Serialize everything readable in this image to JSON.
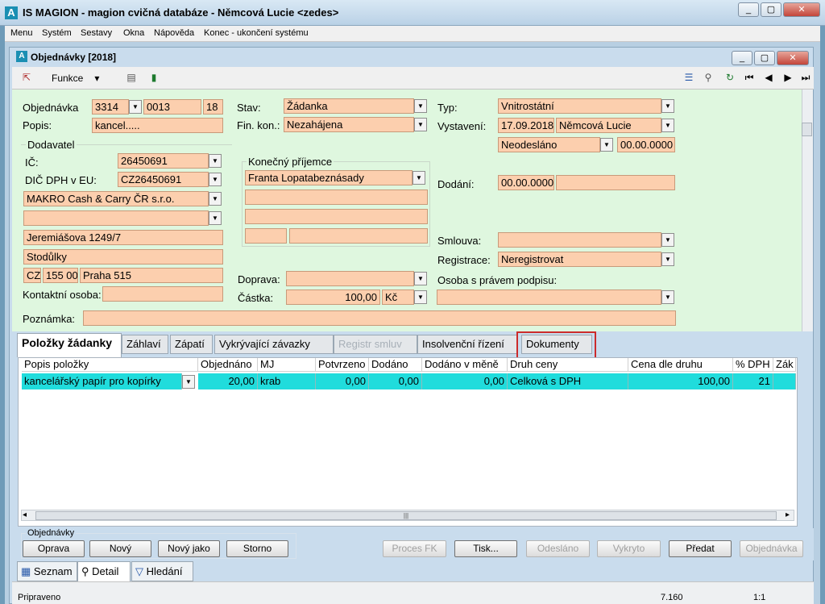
{
  "window": {
    "title": "IS MAGION - magion cvičná databáze - Němcová Lucie <zedes>",
    "logo": "A",
    "min": "▭",
    "max": "▢",
    "close": "✕"
  },
  "menu": [
    "Menu",
    "Systém",
    "Sestavy",
    "Okna",
    "Nápověda",
    "Konec - ukončení systému"
  ],
  "child": {
    "title": "Objednávky [2018]",
    "logo": "A"
  },
  "toolbar": {
    "funkce": "Funkce",
    "caret": "▾",
    "icons": [
      "export-icon",
      "print-icon",
      "book-icon",
      "list-icon",
      "search-doc-icon",
      "refresh-icon",
      "first-icon",
      "prev-icon",
      "next-icon",
      "last-icon"
    ],
    "glyphs": [
      "⇱",
      "▤",
      "▮",
      "☰",
      "⚲",
      "↻",
      "⏮",
      "◀",
      "▶",
      "⏭"
    ]
  },
  "form": {
    "objednavka_lbl": "Objednávka",
    "objednavka_rada": "3314",
    "objednavka_cislo": "0013",
    "objednavka_rok": "18",
    "popis_lbl": "Popis:",
    "popis": "kancel.....",
    "dodavatel_lbl": "Dodavatel",
    "ic_lbl": "IČ:",
    "ic": "26450691",
    "dic_lbl": "DIČ DPH v EU:",
    "dic": "CZ26450691",
    "firma": "MAKRO Cash & Carry ČR s.r.o.",
    "firma2": "",
    "ulice": "Jeremiášova 1249/7",
    "obec": "Stodůlky",
    "zeme": "CZ",
    "psc": "155 00",
    "mesto": "Praha 515",
    "kontakt_lbl": "Kontaktní osoba:",
    "kontakt": "",
    "poznamka_lbl": "Poznámka:",
    "poznamka": "",
    "stav_lbl": "Stav:",
    "stav": "Žádanka",
    "finkon_lbl": "Fin. kon.:",
    "finkon": "Nezahájena",
    "prijemce_lbl": "Konečný příjemce",
    "prijemce": "Franta Lopatabeznásady",
    "doprava_lbl": "Doprava:",
    "doprava": "",
    "castka_lbl": "Částka:",
    "castka": "100,00",
    "mena": "Kč",
    "typ_lbl": "Typ:",
    "typ": "Vnitrostátní",
    "vystaveni_lbl": "Vystavení:",
    "vystaveni_datum": "17.09.2018",
    "vystaveni_osoba": "Němcová Lucie",
    "odeslano": "Neodesláno",
    "odeslano_datum": "00.00.0000",
    "dodani_lbl": "Dodání:",
    "dodani": "00.00.0000",
    "smlouva_lbl": "Smlouva:",
    "smlouva": "",
    "registrace_lbl": "Registrace:",
    "registrace": "Neregistrovat",
    "podpis_lbl": "Osoba s právem podpisu:",
    "podpis": "",
    "dd": "▼"
  },
  "tabs": [
    "Položky žádanky",
    "Záhlaví",
    "Zápatí",
    "Vykrývající závazky",
    "Registr smluv",
    "Insolvenční řízení",
    "Dokumenty"
  ],
  "grid": {
    "headers": [
      "Popis položky",
      "Objednáno",
      "MJ",
      "Potvrzeno",
      "Dodáno",
      "Dodáno v měně",
      "Druh ceny",
      "Cena dle druhu",
      "% DPH",
      "Zák"
    ],
    "row": [
      "kancelářský papír pro kopírky",
      "20,00",
      "krab",
      "0,00",
      "0,00",
      "0,00",
      "Celková s DPH",
      "100,00",
      "21",
      ""
    ],
    "scroll_left": "◂",
    "scroll_right": "▸",
    "scroll_grip": "|||"
  },
  "buttons": {
    "group_lbl": "Objednávky",
    "oprava": "Oprava",
    "novy": "Nový",
    "novy_jako": "Nový jako",
    "storno": "Storno",
    "proces": "Proces FK",
    "tisk": "Tisk...",
    "odeslano": "Odesláno",
    "vykryto": "Vykryto",
    "predat": "Předat",
    "objednavka": "Objednávka"
  },
  "bottom_tabs": {
    "seznam": "Seznam",
    "detail": "Detail",
    "hledani": "Hledání"
  },
  "status": {
    "left": "Pripraveno",
    "middle": "7.160",
    "right": "1:1"
  }
}
